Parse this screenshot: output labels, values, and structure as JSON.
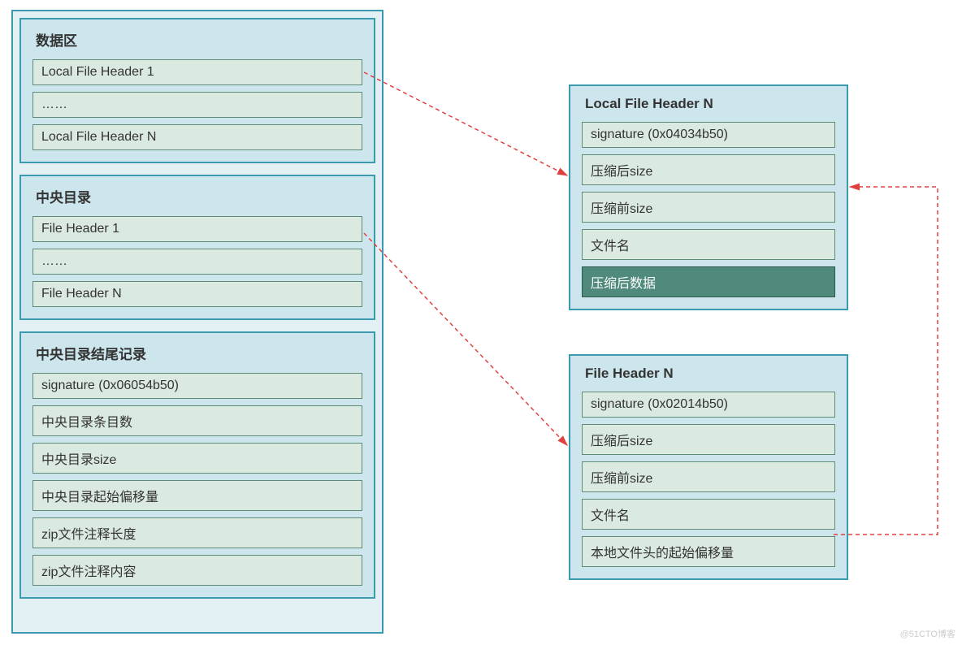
{
  "outer": {
    "dataArea": {
      "title": "数据区",
      "items": [
        "Local File Header 1",
        "……",
        "Local File Header N"
      ]
    },
    "centralDir": {
      "title": "中央目录",
      "items": [
        "File Header 1",
        "……",
        "File Header N"
      ]
    },
    "endRecord": {
      "title": "中央目录结尾记录",
      "items": [
        "signature (0x06054b50)",
        "中央目录条目数",
        "中央目录size",
        "中央目录起始偏移量",
        "zip文件注释长度",
        "zip文件注释内容"
      ]
    }
  },
  "localHeader": {
    "title": "Local File Header N",
    "items": [
      "signature (0x04034b50)",
      "压缩后size",
      "压缩前size",
      "文件名",
      "压缩后数据"
    ]
  },
  "fileHeader": {
    "title": "File Header N",
    "items": [
      "signature (0x02014b50)",
      "压缩后size",
      "压缩前size",
      "文件名",
      "本地文件头的起始偏移量"
    ]
  },
  "watermark": "@51CTO博客"
}
